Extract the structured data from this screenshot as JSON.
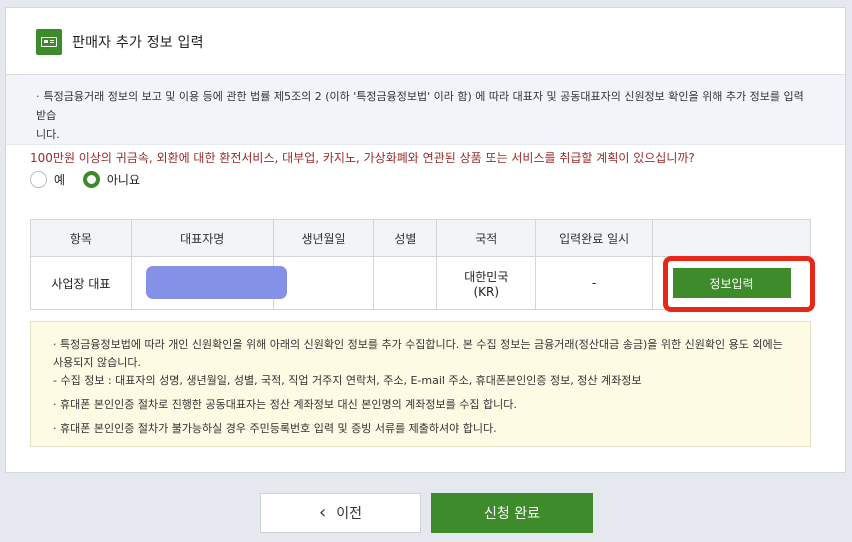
{
  "header": {
    "title": "판매자 추가 정보 입력",
    "icon": "id-card-icon"
  },
  "notice": {
    "bullet": "·",
    "line1": "특정금융거래 정보의 보고 및 이용 등에 관한 법률 제5조의 2 (이하 '특정금융정보법' 이라 함) 에 따라 대표자 및 공동대표자의 신원정보 확인을 위해 추가 정보를 입력 받습",
    "line2": "니다."
  },
  "question": {
    "text": "100만원 이상의 귀금속, 외환에 대한 환전서비스, 대부업, 카지노, 가상화폐와 연관된 상품 또는 서비스를 취급할 계획이 있으십니까?",
    "options": [
      {
        "label": "예",
        "selected": false
      },
      {
        "label": "아니요",
        "selected": true
      }
    ]
  },
  "table": {
    "headers": [
      "항목",
      "대표자명",
      "생년월일",
      "성별",
      "국적",
      "입력완료 일시",
      ""
    ],
    "row": {
      "category": "사업장 대표",
      "nationality_line1": "대한민국",
      "nationality_line2": "(KR)",
      "completed_at": "-",
      "button_label": "정보입력"
    }
  },
  "guide": {
    "items": [
      "특정금융정보법에 따라 개인 신원확인을 위해 아래의 신원확인 정보를 추가 수집합니다. 본 수집 정보는 금융거래(정산대금 송금)을 위한 신원확인 용도 외에는 사용되지 않습니다.",
      "- 수집 정보 : 대표자의 성명, 생년월일, 성별, 국적, 직업 거주지 연락처, 주소, E-mail 주소, 휴대폰본인인증 정보, 정산 계좌정보",
      "휴대폰 본인인증 절차로 진행한 공동대표자는 정산 계좌정보 대신 본인명의 계좌정보를 수집 합니다.",
      "휴대폰 본인인증 절차가 불가능하실 경우 주민등록번호 입력 및 증빙 서류를 제출하셔야 합니다."
    ]
  },
  "buttons": {
    "prev": "이전",
    "submit": "신청 완료"
  },
  "colors": {
    "accent": "#3d8b2b",
    "question": "#9b2a2a",
    "highlight": "#e8261a",
    "redacted": "#8491e6"
  }
}
